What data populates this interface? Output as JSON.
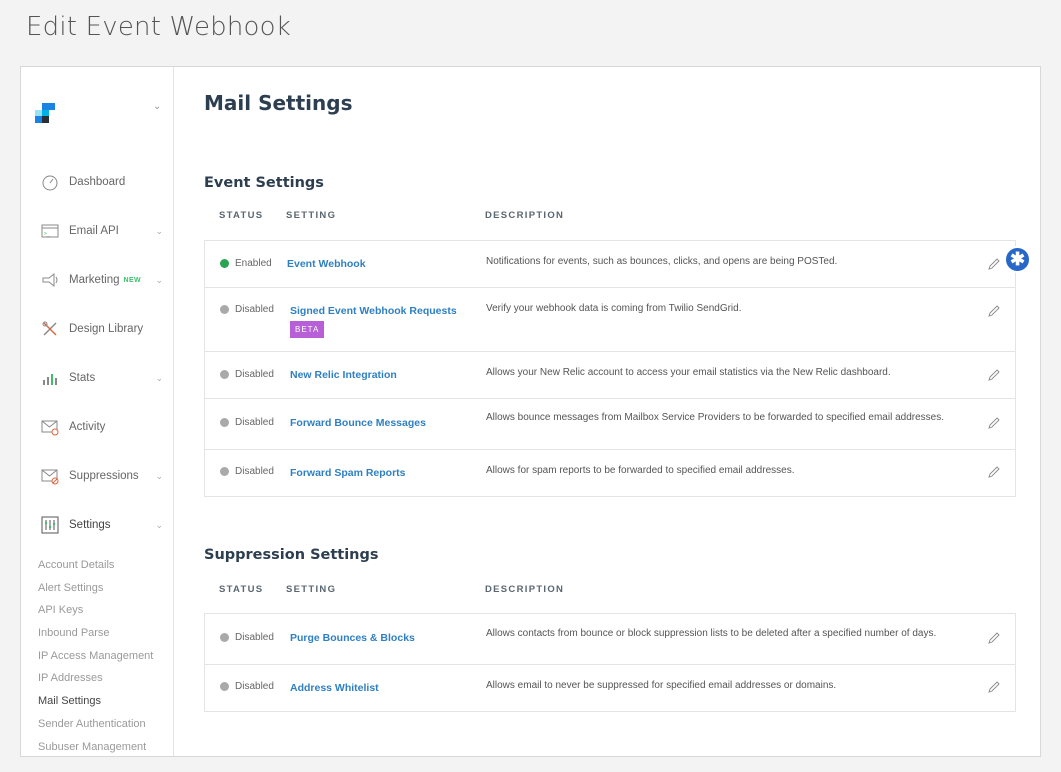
{
  "doc_title": "Edit Event Webhook",
  "sidebar": {
    "logo_icon": "sendgrid-logo-icon",
    "items": [
      {
        "label": "Dashboard",
        "icon": "dashboard-gauge-icon",
        "has_chevron": false
      },
      {
        "label": "Email API",
        "icon": "terminal-icon",
        "has_chevron": true
      },
      {
        "label": "Marketing",
        "badge": "NEW",
        "icon": "megaphone-icon",
        "has_chevron": true
      },
      {
        "label": "Design Library",
        "icon": "design-tools-icon",
        "has_chevron": false
      },
      {
        "label": "Stats",
        "icon": "bar-chart-icon",
        "has_chevron": true
      },
      {
        "label": "Activity",
        "icon": "activity-envelope-icon",
        "has_chevron": false
      },
      {
        "label": "Suppressions",
        "icon": "suppression-envelope-icon",
        "has_chevron": true
      },
      {
        "label": "Settings",
        "icon": "settings-sliders-icon",
        "has_chevron": true
      }
    ],
    "settings_sub": [
      "Account Details",
      "Alert Settings",
      "API Keys",
      "Inbound Parse",
      "IP Access Management",
      "IP Addresses",
      "Mail Settings",
      "Sender Authentication",
      "Subuser Management"
    ],
    "active_sub": "Mail Settings"
  },
  "main": {
    "title": "Mail Settings",
    "columns": {
      "status": "STATUS",
      "setting": "SETTING",
      "description": "DESCRIPTION"
    },
    "event_section": {
      "title": "Event Settings",
      "rows": [
        {
          "status": "Enabled",
          "setting": "Event Webhook",
          "description": "Notifications for events, such as bounces, clicks, and opens are being POSTed."
        },
        {
          "status": "Disabled",
          "setting": "Signed Event Webhook Requests",
          "badge": "BETA",
          "description": "Verify your webhook data is coming from Twilio SendGrid."
        },
        {
          "status": "Disabled",
          "setting": "New Relic Integration",
          "description": "Allows your New Relic account to access your email statistics via the New Relic dashboard."
        },
        {
          "status": "Disabled",
          "setting": "Forward Bounce Messages",
          "description": "Allows bounce messages from Mailbox Service Providers to be forwarded to specified email addresses."
        },
        {
          "status": "Disabled",
          "setting": "Forward Spam Reports",
          "description": "Allows for spam reports to be forwarded to specified email addresses."
        }
      ]
    },
    "suppression_section": {
      "title": "Suppression Settings",
      "rows": [
        {
          "status": "Disabled",
          "setting": "Purge Bounces & Blocks",
          "description": "Allows contacts from bounce or block suppression lists to be deleted after a specified number of days."
        },
        {
          "status": "Disabled",
          "setting": "Address Whitelist",
          "description": "Allows email to never be suppressed for specified email addresses or domains."
        }
      ]
    },
    "help_glyph": "✱"
  }
}
